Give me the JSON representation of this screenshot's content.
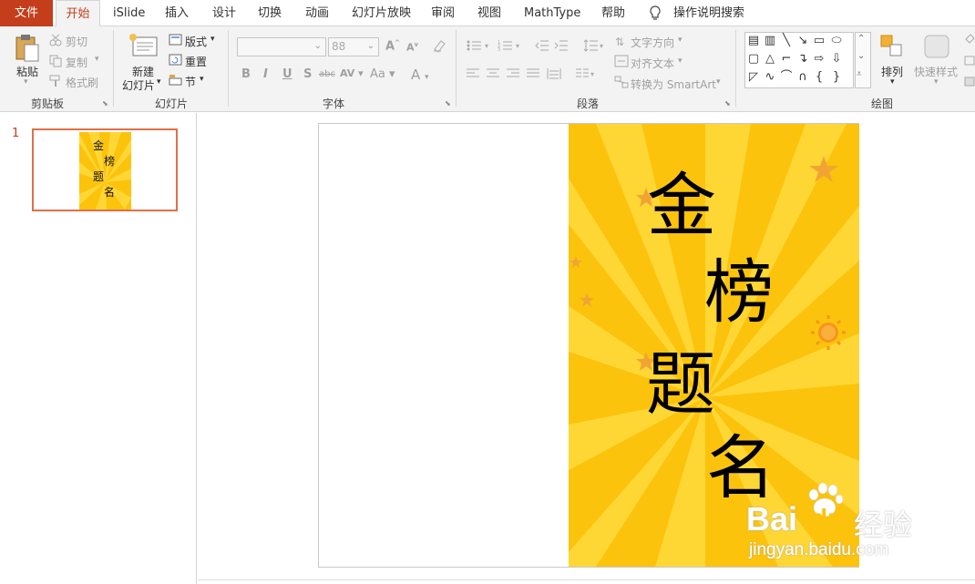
{
  "tabs": [
    "文件",
    "开始",
    "iSlide",
    "插入",
    "设计",
    "切换",
    "动画",
    "幻灯片放映",
    "审阅",
    "视图",
    "MathType",
    "帮助"
  ],
  "tell_me": "操作说明搜索",
  "clipboard": {
    "paste": "粘贴",
    "cut": "剪切",
    "copy": "复制",
    "format_painter": "格式刷",
    "group": "剪贴板"
  },
  "slides_group": {
    "new_slide_1": "新建",
    "new_slide_2": "幻灯片",
    "layout": "版式",
    "reset": "重置",
    "section": "节",
    "group": "幻灯片"
  },
  "font": {
    "name": "",
    "size": "88",
    "group": "字体",
    "bold": "B",
    "italic": "I",
    "underline": "U",
    "shadow": "S",
    "strike": "abc",
    "spacing": "AV",
    "case": "Aa",
    "color": "A",
    "grow": "A",
    "shrink": "A"
  },
  "paragraph": {
    "text_direction": "文字方向",
    "align_text": "对齐文本",
    "smartart": "转换为 SmartArt",
    "group": "段落"
  },
  "drawing": {
    "arrange": "排列",
    "quick_styles": "快速样式",
    "group": "绘图"
  },
  "thumbnail": {
    "number": "1",
    "chars": [
      "金",
      "榜",
      "题",
      "名"
    ]
  },
  "slide_content": {
    "chars": [
      "金",
      "榜",
      "题",
      "名"
    ]
  },
  "watermark": {
    "brand": "Bai",
    "brand2": "du",
    "cn": "经验",
    "url": "jingyan.baidu.com"
  },
  "colors": {
    "accent": "#c43e1c",
    "poster_bg": "#fcc30d",
    "poster_ray": "#ffd735",
    "thumb_border": "#e07048"
  }
}
